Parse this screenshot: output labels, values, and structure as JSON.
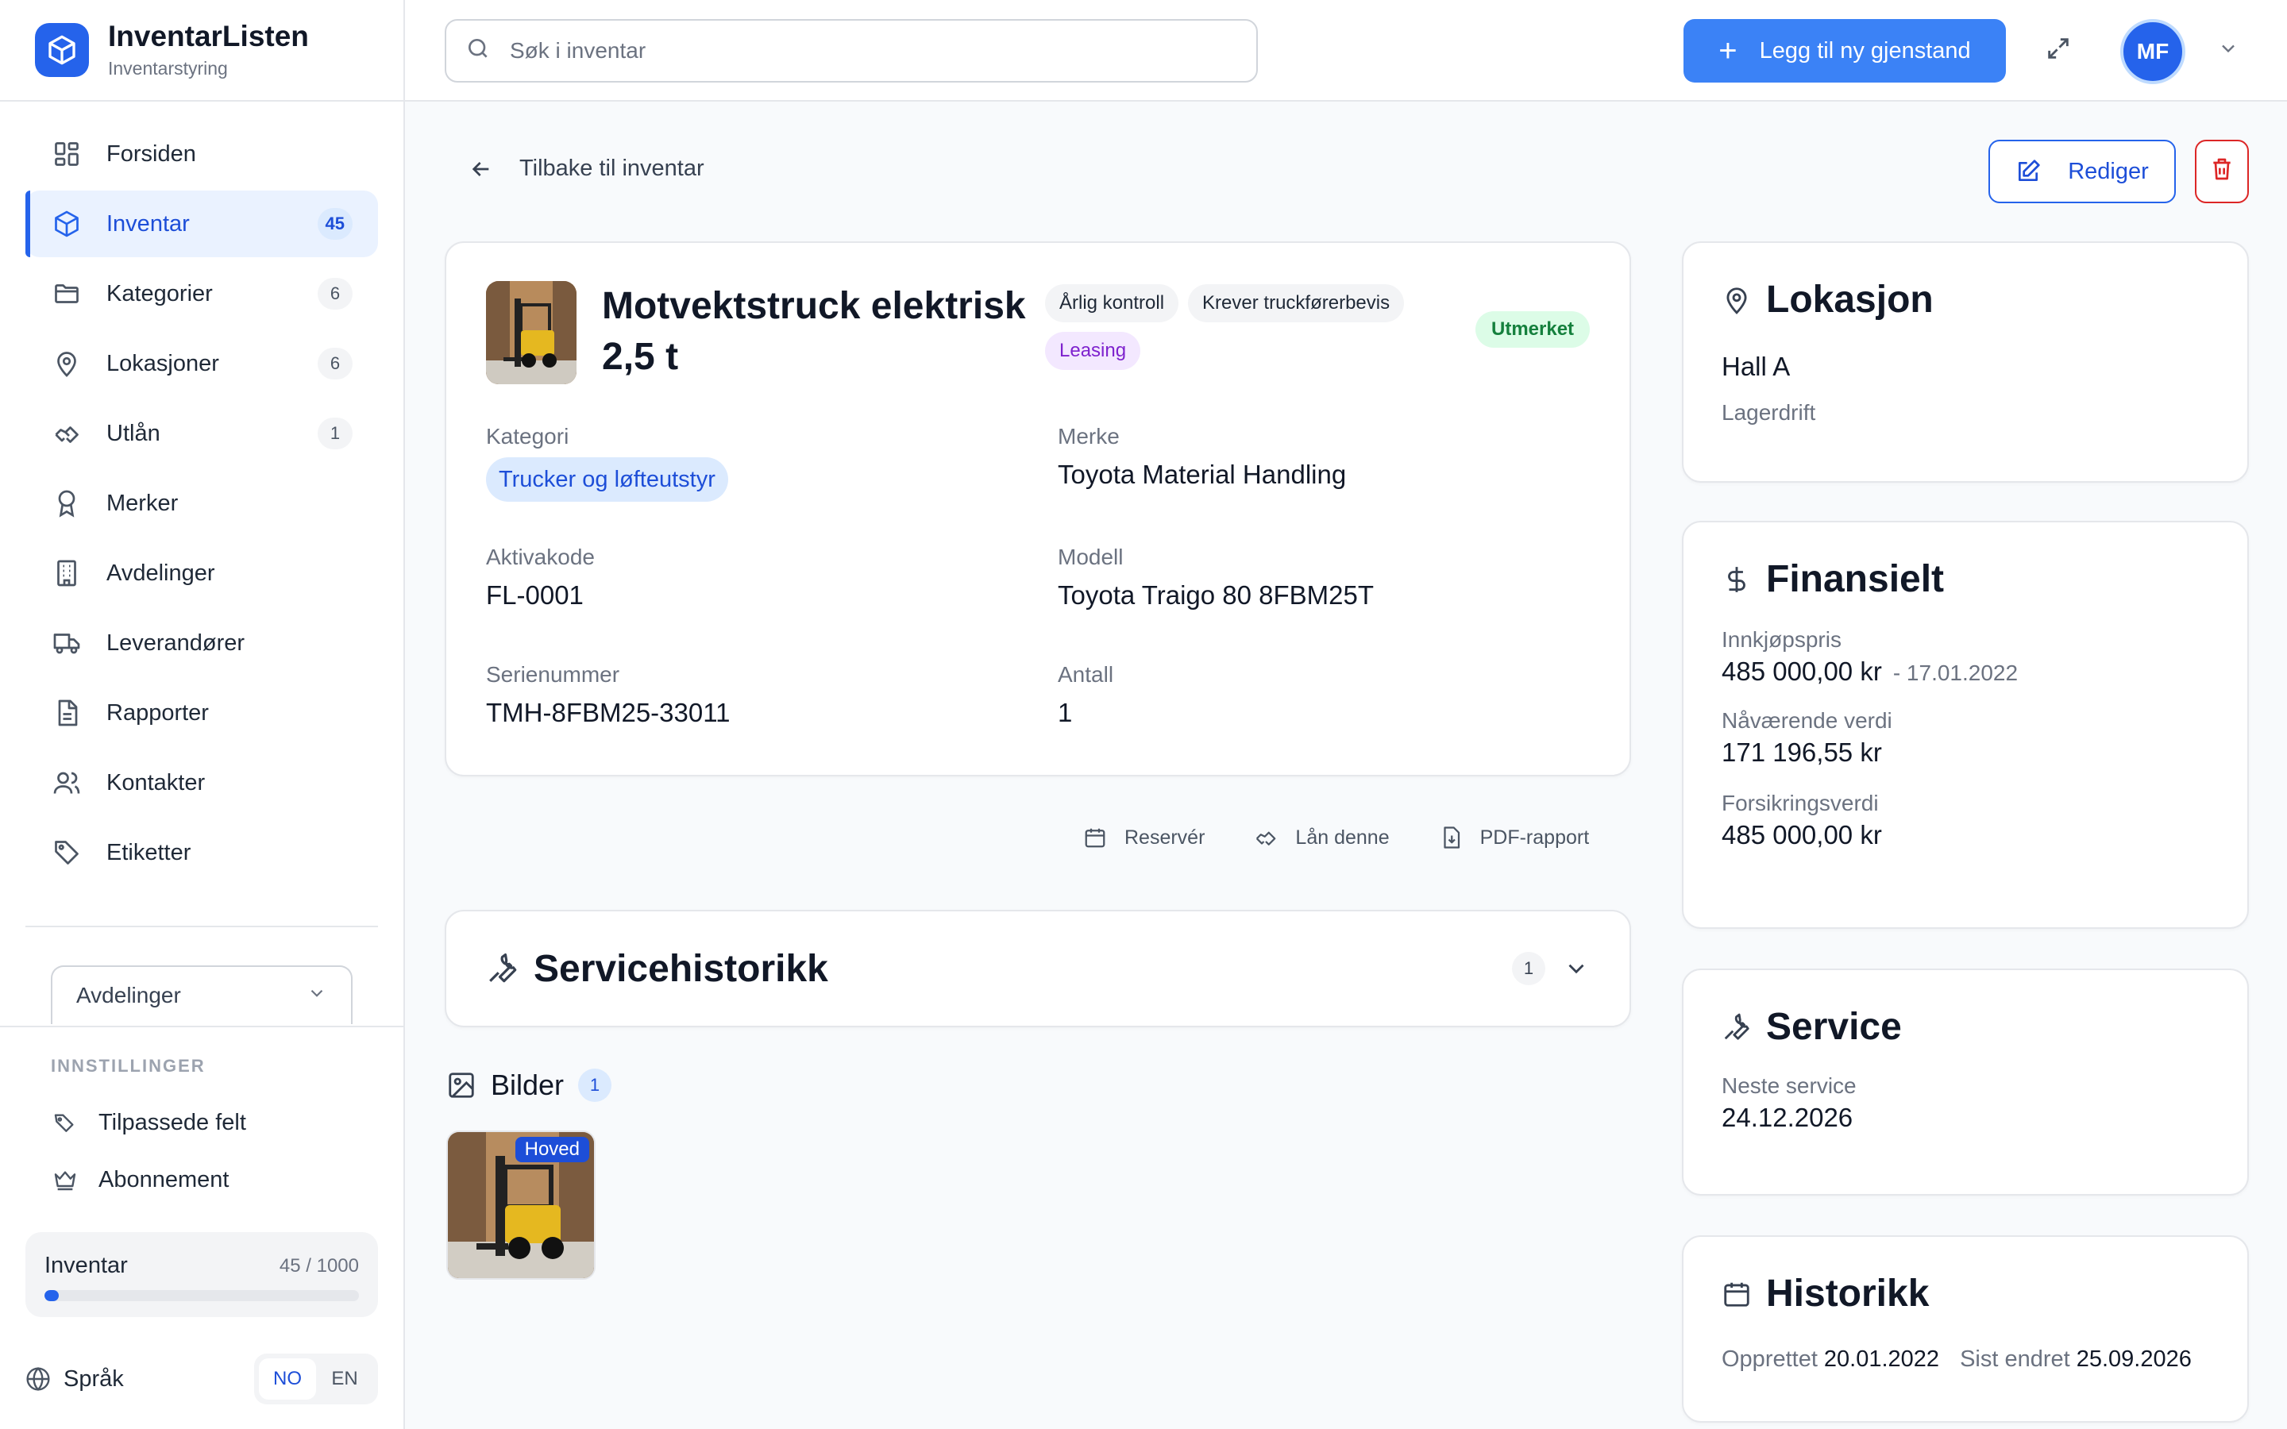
{
  "app": {
    "title": "InventarListen",
    "subtitle": "Inventarstyring"
  },
  "sidebar": {
    "items": [
      {
        "label": "Forsiden",
        "badge": "",
        "icon": "dashboard-icon"
      },
      {
        "label": "Inventar",
        "badge": "45",
        "icon": "box-icon",
        "active": true
      },
      {
        "label": "Kategorier",
        "badge": "6",
        "icon": "folder-icon"
      },
      {
        "label": "Lokasjoner",
        "badge": "6",
        "icon": "map-pin-icon"
      },
      {
        "label": "Utlån",
        "badge": "1",
        "icon": "handshake-icon"
      },
      {
        "label": "Merker",
        "badge": "",
        "icon": "award-icon"
      },
      {
        "label": "Avdelinger",
        "badge": "",
        "icon": "building-icon"
      },
      {
        "label": "Leverandører",
        "badge": "",
        "icon": "truck-icon"
      },
      {
        "label": "Rapporter",
        "badge": "",
        "icon": "document-icon"
      },
      {
        "label": "Kontakter",
        "badge": "",
        "icon": "users-icon"
      },
      {
        "label": "Etiketter",
        "badge": "",
        "icon": "tag-icon"
      }
    ],
    "department_select": "Avdelinger",
    "settings_heading": "INNSTILLINGER",
    "settings_items": [
      {
        "label": "Tilpassede felt",
        "icon": "tags-icon"
      },
      {
        "label": "Abonnement",
        "icon": "crown-icon"
      }
    ],
    "usage": {
      "label": "Inventar",
      "count": "45 / 1000",
      "fraction": 0.045
    },
    "language": {
      "label": "Språk",
      "options": [
        "NO",
        "EN"
      ],
      "selected": "NO"
    }
  },
  "topbar": {
    "search_placeholder": "Søk i inventar",
    "add_button": "Legg til ny gjenstand",
    "avatar_initials": "MF"
  },
  "detail": {
    "back_label": "Tilbake til inventar",
    "edit_label": "Rediger",
    "title": "Motvektstruck elektrisk 2,5 t",
    "tags": [
      "Årlig kontroll",
      "Krever truckførerbevis",
      "Leasing"
    ],
    "status": "Utmerket",
    "fields": {
      "category_label": "Kategori",
      "category_value": "Trucker og løfteutstyr",
      "brand_label": "Merke",
      "brand_value": "Toyota Material Handling",
      "asset_code_label": "Aktivakode",
      "asset_code_value": "FL-0001",
      "model_label": "Modell",
      "model_value": "Toyota Traigo 80 8FBM25T",
      "serial_label": "Serienummer",
      "serial_value": "TMH-8FBM25-33011",
      "quantity_label": "Antall",
      "quantity_value": "1"
    },
    "actions": {
      "reserve": "Reservér",
      "loan": "Lån denne",
      "pdf": "PDF-rapport"
    },
    "service_history": {
      "title": "Servicehistorikk",
      "count": "1"
    },
    "images": {
      "title": "Bilder",
      "count": "1",
      "main_label": "Hoved"
    }
  },
  "location": {
    "title": "Lokasjon",
    "name": "Hall A",
    "sub": "Lagerdrift"
  },
  "financial": {
    "title": "Finansielt",
    "purchase_label": "Innkjøpspris",
    "purchase_value": "485 000,00 kr",
    "purchase_date": "- 17.01.2022",
    "current_label": "Nåværende verdi",
    "current_value": "171 196,55 kr",
    "insurance_label": "Forsikringsverdi",
    "insurance_value": "485 000,00 kr"
  },
  "service": {
    "title": "Service",
    "next_label": "Neste service",
    "next_value": "24.12.2026"
  },
  "history": {
    "title": "Historikk",
    "created_label": "Opprettet",
    "created_value": "20.01.2022",
    "changed_label": "Sist endret",
    "changed_value": "25.09.2026"
  },
  "colors": {
    "accent": "#2563eb",
    "button": "#3b82f6",
    "danger": "#dc2626",
    "success_bg": "#dcfce7",
    "success_text": "#15803d"
  }
}
